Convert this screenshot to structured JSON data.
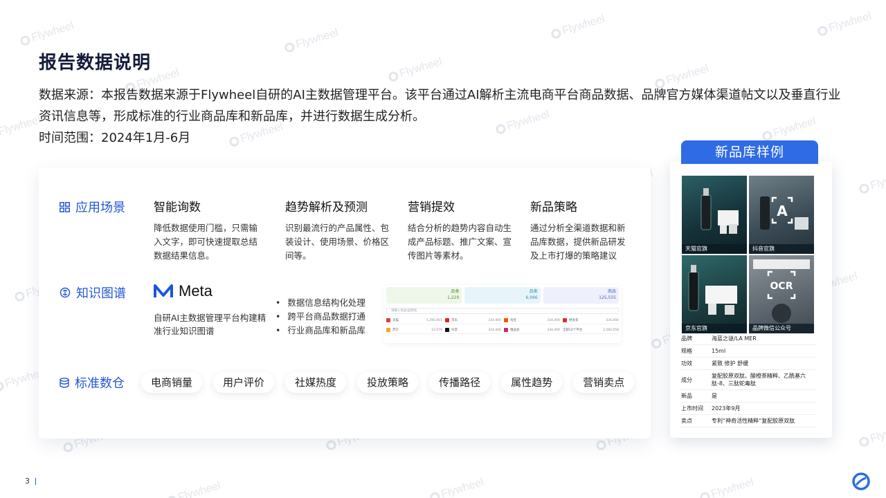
{
  "watermark_text": "Flywheel",
  "title": "报告数据说明",
  "intro": {
    "source": "数据来源：本报告数据来源于Flywheel自研的AI主数据管理平台。该平台通过AI解析主流电商平台商品数据、品牌官方媒体渠道帖文以及垂直行业资讯信息等，形成标准的行业商品库和新品库，并进行数据生成分析。",
    "period": "时间范围：2024年1月-6月"
  },
  "sections": {
    "scenarios": {
      "label": "应用场景",
      "icon": "grid-icon",
      "items": [
        {
          "title": "智能询数",
          "desc": "降低数据使用门槛，只需输入文字，即可快速提取总结数据结果信息。"
        },
        {
          "title": "趋势解析及预测",
          "desc": "识别最流行的产品属性、包装设计、使用场景、价格区间等。"
        },
        {
          "title": "营销提效",
          "desc": "结合分析的趋势内容自动生成产品标题、推广文案、宣传图片等素材。"
        },
        {
          "title": "新品策略",
          "desc": "通过分析全渠道数据和新品库数据，提供新品研发及上市打爆的策略建议"
        }
      ]
    },
    "knowledge": {
      "label": "知识图谱",
      "icon": "brain-icon",
      "meta_name": "Meta",
      "meta_desc": "自研AI主数据管理平台构建精准行业知识图谱",
      "bullets": [
        "数据信息结构化处理",
        "跨平台商品数据打通",
        "行业商品库和新品库"
      ],
      "mini_dashboard": {
        "cards": [
          {
            "label": "品类",
            "value": "1,229"
          },
          {
            "label": "品类",
            "value": "6,066"
          },
          {
            "label": "商品",
            "value": "125,555"
          }
        ],
        "search_placeholder": "请输入商品/品牌名",
        "rows": [
          {
            "name": "天猫",
            "value": "1,395,601"
          },
          {
            "name": "京东",
            "value": "334,400"
          },
          {
            "name": "淘宝",
            "value": "334,400"
          },
          {
            "name": "拼多多",
            "value": "334,400"
          },
          {
            "name": "苏宁",
            "value": "22,079"
          },
          {
            "name": "抖音",
            "value": "334,400"
          },
          {
            "name": "唯品会",
            "value": "334,400"
          },
          {
            "name": "全部14个平台",
            "value": "2,580,058"
          }
        ]
      }
    },
    "warehouse": {
      "label": "标准数仓",
      "icon": "database-icon",
      "chips": [
        "电商销量",
        "用户评价",
        "社媒热度",
        "投放策略",
        "传播路径",
        "属性趋势",
        "营销卖点"
      ]
    }
  },
  "sample": {
    "tab_title": "新品库样例",
    "images": [
      {
        "caption": "天猫官旗"
      },
      {
        "caption": "抖音官旗"
      },
      {
        "caption": "京东官旗"
      },
      {
        "caption": "品牌微信公众号"
      }
    ],
    "attributes": [
      {
        "key": "品牌",
        "value": "海蓝之谜/LA MER"
      },
      {
        "key": "规格",
        "value": "15ml"
      },
      {
        "key": "功效",
        "value": "紧致 修护 舒缓"
      },
      {
        "key": "成分",
        "value": "复配胶原双肽、酸橙茶精粹、乙酰基六肽-8、三肽蛇毒肽"
      },
      {
        "key": "新品",
        "value": "是"
      },
      {
        "key": "上市时间",
        "value": "2023年9月"
      },
      {
        "key": "卖点",
        "value": "专利“神奇活性精粹”复配胶原双肽"
      }
    ]
  },
  "footer": {
    "page": "3"
  },
  "colors": {
    "accent": "#2457d6",
    "tab": "#2f6be4",
    "title": "#131a3a"
  }
}
